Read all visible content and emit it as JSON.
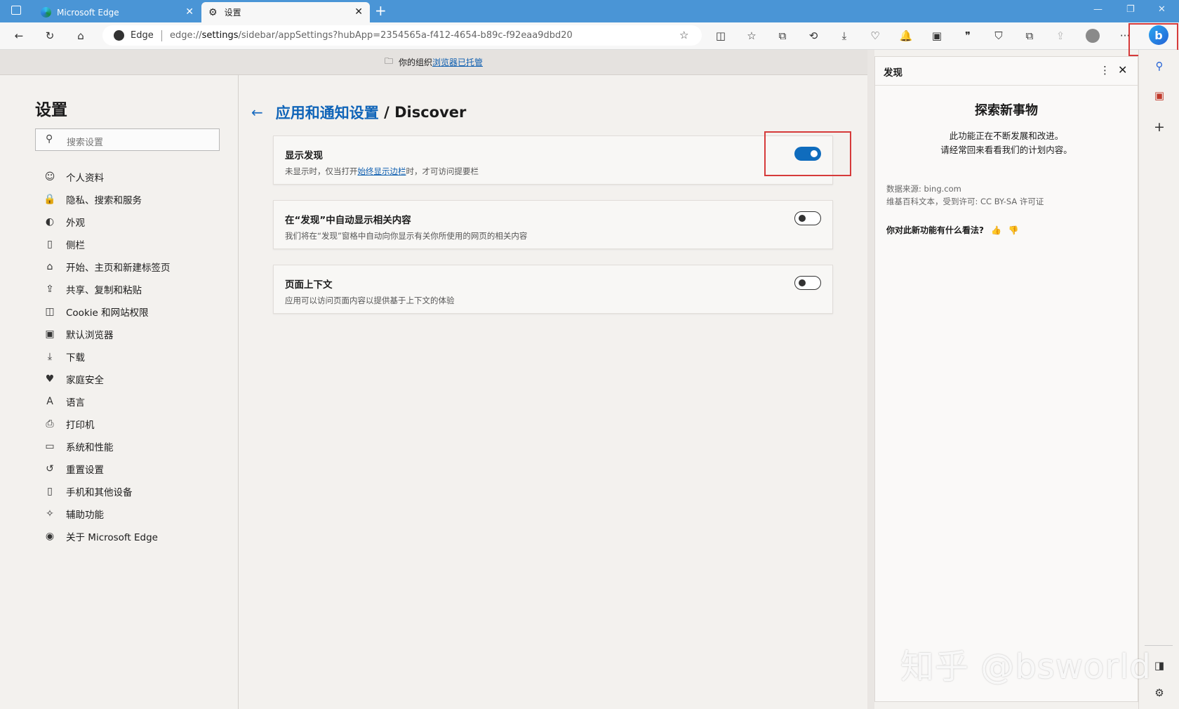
{
  "tabs": [
    {
      "label": "Microsoft Edge",
      "icon": "edge-logo-icon"
    },
    {
      "label": "设置",
      "icon": "gear-icon"
    }
  ],
  "address": {
    "site_label": "Edge",
    "url_prefix": "edge://",
    "url_host": "settings",
    "url_rest": "/sidebar/appSettings?hubApp=2354565a-f412-4654-b89c-f92eaa9dbd20"
  },
  "managed_bar": {
    "text": "你的组织",
    "link": "浏览器已托管"
  },
  "sidebar": {
    "title": "设置",
    "search_placeholder": "搜索设置",
    "items": [
      {
        "label": "个人资料",
        "icon": "profile-icon"
      },
      {
        "label": "隐私、搜索和服务",
        "icon": "lock-icon"
      },
      {
        "label": "外观",
        "icon": "appearance-icon"
      },
      {
        "label": "侧栏",
        "icon": "sidebar-icon"
      },
      {
        "label": "开始、主页和新建标签页",
        "icon": "home-page-icon"
      },
      {
        "label": "共享、复制和粘贴",
        "icon": "share-icon"
      },
      {
        "label": "Cookie 和网站权限",
        "icon": "cookie-icon"
      },
      {
        "label": "默认浏览器",
        "icon": "default-browser-icon"
      },
      {
        "label": "下载",
        "icon": "download-icon"
      },
      {
        "label": "家庭安全",
        "icon": "family-icon"
      },
      {
        "label": "语言",
        "icon": "language-icon"
      },
      {
        "label": "打印机",
        "icon": "printer-icon"
      },
      {
        "label": "系统和性能",
        "icon": "system-icon"
      },
      {
        "label": "重置设置",
        "icon": "reset-icon"
      },
      {
        "label": "手机和其他设备",
        "icon": "phone-icon"
      },
      {
        "label": "辅助功能",
        "icon": "accessibility-icon"
      },
      {
        "label": "关于 Microsoft Edge",
        "icon": "edge-logo-icon"
      }
    ]
  },
  "main": {
    "breadcrumb_parent": "应用和通知设置",
    "breadcrumb_sep": " / ",
    "breadcrumb_current": "Discover",
    "settings": [
      {
        "title": "显示发现",
        "desc_pre": "未显示时，仅当打开",
        "desc_link": "始终显示边栏",
        "desc_post": "时，才可访问提要栏",
        "enabled": true
      },
      {
        "title": "在“发现”中自动显示相关内容",
        "desc_pre": "我们将在“发现”窗格中自动向你显示有关你所使用的网页的相关内容",
        "desc_link": "",
        "desc_post": "",
        "enabled": false
      },
      {
        "title": "页面上下文",
        "desc_pre": "应用可以访问页面内容以提供基于上下文的体验",
        "desc_link": "",
        "desc_post": "",
        "enabled": false
      }
    ]
  },
  "discover_pane": {
    "title": "发现",
    "heading": "探索新事物",
    "desc_line1": "此功能正在不断发展和改进。",
    "desc_line2": "请经常回来看看我们的计划内容。",
    "source1": "数据来源: bing.com",
    "source2": "维基百科文本，受到许可: CC BY-SA 许可证",
    "feedback": "你对此新功能有什么看法?"
  },
  "watermark": "知乎 @bsworld",
  "colors": {
    "accent": "#0f6cbd",
    "titlebar": "#4a95d6",
    "highlight": "#d63a3a"
  }
}
